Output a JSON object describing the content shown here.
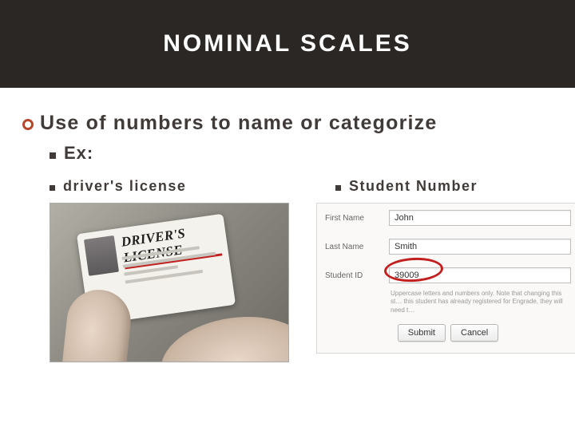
{
  "title": "NOMINAL SCALES",
  "bullet1": "Use of numbers to name or categorize",
  "bullet2": "Ex:",
  "examples": {
    "left_label": "driver's license",
    "right_label": "Student Number"
  },
  "license_card": {
    "heading": "DRIVER'S LICENSE"
  },
  "form": {
    "rows": [
      {
        "label": "First Name",
        "value": "John"
      },
      {
        "label": "Last Name",
        "value": "Smith"
      },
      {
        "label": "Student ID",
        "value": "39009"
      }
    ],
    "hint": "Uppercase letters and numbers only. Note that changing this st… this student has already registered for Engrade, they will need t…",
    "submit": "Submit",
    "cancel": "Cancel"
  }
}
